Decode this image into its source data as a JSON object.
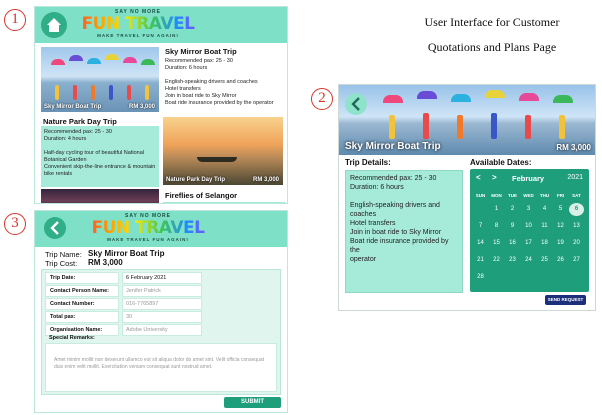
{
  "caption": {
    "line1": "User Interface for Customer",
    "line2": "Quotations and Plans Page"
  },
  "markers": [
    "1",
    "2",
    "3"
  ],
  "brand": {
    "tagline_top": "SAY NO MORE",
    "name": "FUN TRAVEL",
    "tagline_bottom": "MAKE TRAVEL FUN AGAIN!"
  },
  "screen1": {
    "trips": [
      {
        "title": "Sky Mirror Boat Trip",
        "image_label": "Sky Mirror Boat Trip",
        "price": "RM 3,000",
        "details": [
          "Recommended pax: 25 - 30",
          "Duration: 6 hours",
          "",
          "English-speaking drivers and coaches",
          "Hotel transfers",
          "Join in boat ride to Sky Mirror",
          "Boat ride insurance provided by the operator"
        ]
      },
      {
        "title": "Nature Park Day Trip",
        "image_label": "Nature Park Day Trip",
        "price": "RM 3,000",
        "details": [
          "Recommended pax: 25 - 30",
          "Duration: 4 hours",
          "",
          "Half-day cycling tour of beautiful National",
          "Botanical Garden",
          "Convenient skip-the-line entrance & mountain",
          "bike rentals"
        ]
      },
      {
        "title": "Fireflies of Selangor"
      }
    ]
  },
  "screen2": {
    "title": "Sky Mirror Boat Trip",
    "price": "RM 3,000",
    "details_label": "Trip Details:",
    "dates_label": "Available Dates:",
    "details": [
      "Recommended pax: 25 - 30",
      "Duration: 6 hours",
      "",
      "English-speaking drivers and",
      "coaches",
      "Hotel transfers",
      "Join in boat ride to Sky Mirror",
      "Boat ride insurance provided by the",
      "operator"
    ],
    "calendar": {
      "prev": "<",
      "next": ">",
      "month": "February",
      "year": "2021",
      "weekdays": [
        "SUN",
        "MON",
        "TUE",
        "WED",
        "THU",
        "FRI",
        "SAT"
      ],
      "start_offset": 1,
      "days": 28,
      "selected_day": 6
    },
    "send_request": "SEND REQUEST"
  },
  "screen3": {
    "trip_name_label": "Trip Name:",
    "trip_name": "Sky Mirror Boat Trip",
    "trip_cost_label": "Trip Cost:",
    "trip_cost": "RM 3,000",
    "fields": [
      {
        "label": "Trip Date:",
        "value": "6 February 2021",
        "filled": true
      },
      {
        "label": "Contact Person Name:",
        "value": "Jenifer Patrick",
        "filled": false
      },
      {
        "label": "Contact Number:",
        "value": "016-7765897",
        "filled": false
      },
      {
        "label": "Total pax:",
        "value": "30",
        "filled": false
      },
      {
        "label": "Organisation Name:",
        "value": "Adobe University",
        "filled": false
      }
    ],
    "remarks_label": "Special Remarks:",
    "remarks_placeholder": "Amet minim mollit non deserunt ullamco est sit aliqua dolor do amet sint. Velit officia consequat duis enim velit mollit. Exercitation veniam consequat sunt nostrud amet.",
    "submit": "SUBMIT"
  },
  "colors": {
    "mint": "#7fe0c8",
    "teal": "#1f9e7c",
    "panel": "#a6ebd9",
    "navy": "#1c2f7a",
    "marker": "#d9342b"
  }
}
